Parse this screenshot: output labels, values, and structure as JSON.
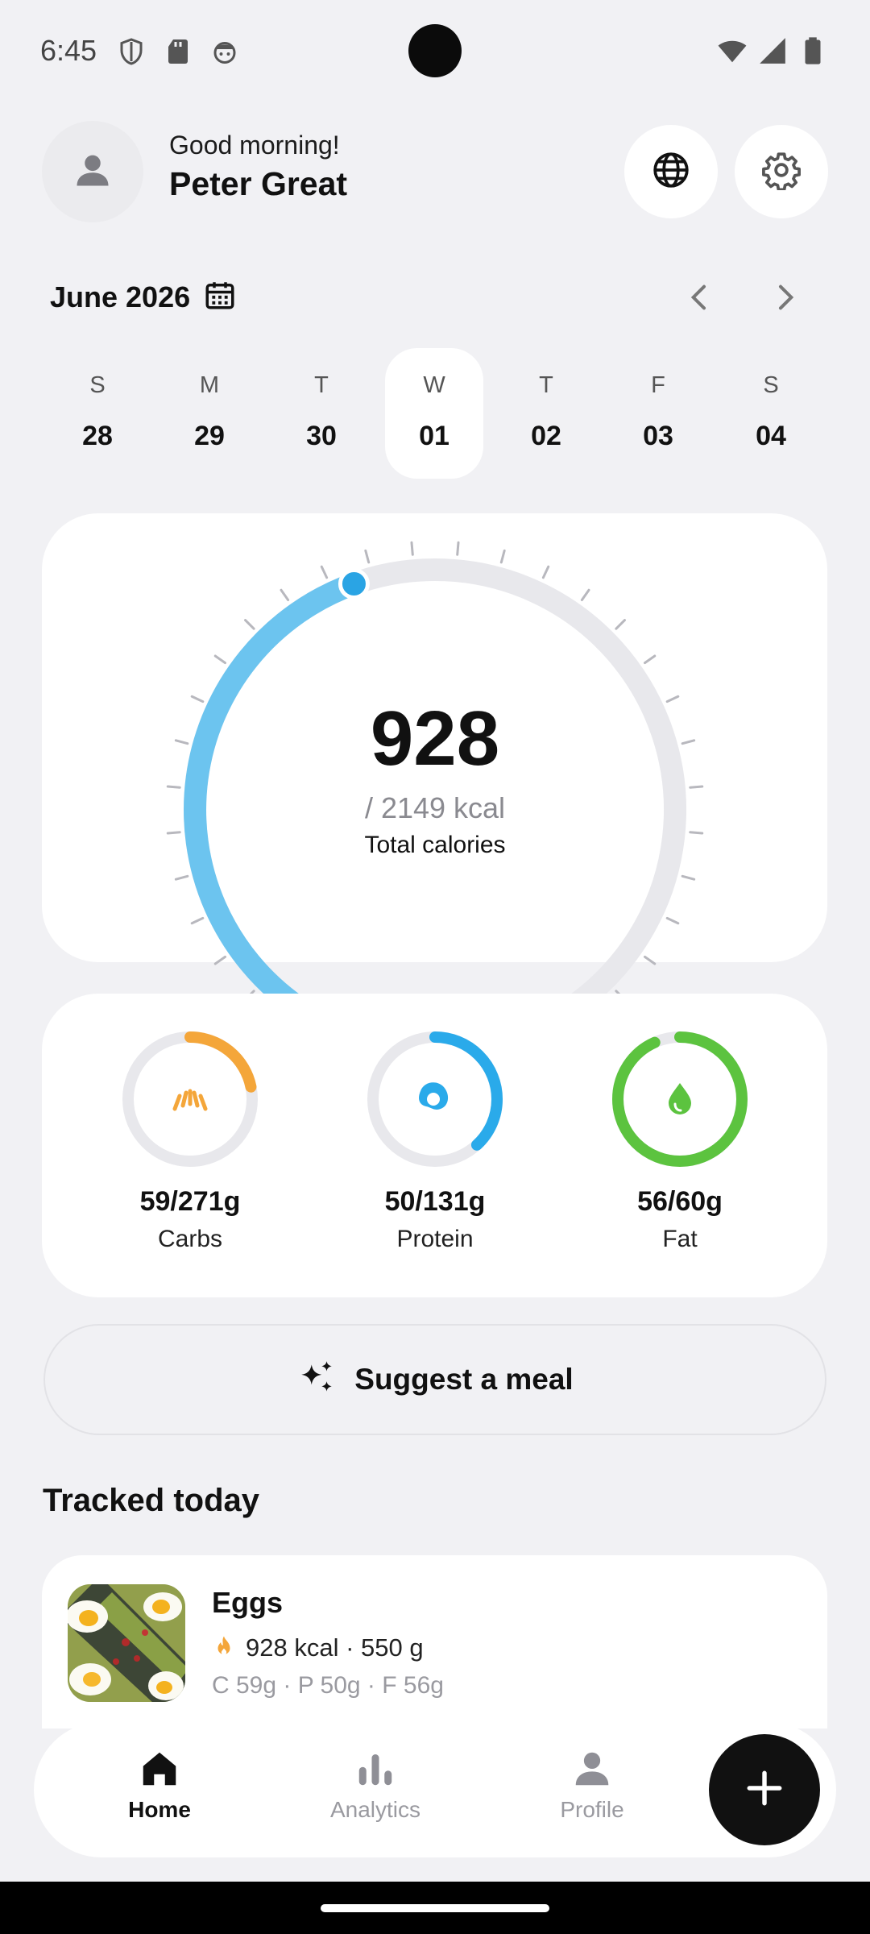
{
  "status_bar": {
    "time": "6:45"
  },
  "header": {
    "greeting": "Good morning!",
    "user_name": "Peter Great"
  },
  "calendar": {
    "month_label": "June 2026",
    "days": [
      {
        "letter": "S",
        "number": "28"
      },
      {
        "letter": "M",
        "number": "29"
      },
      {
        "letter": "T",
        "number": "30"
      },
      {
        "letter": "W",
        "number": "01",
        "selected": true
      },
      {
        "letter": "T",
        "number": "02"
      },
      {
        "letter": "F",
        "number": "03"
      },
      {
        "letter": "S",
        "number": "04"
      }
    ]
  },
  "calories": {
    "consumed": "928",
    "goal_text": "/ 2149 kcal",
    "label": "Total calories",
    "progress": 0.432,
    "color": "#6cc4ef"
  },
  "macros": [
    {
      "value": "59/271g",
      "name": "Carbs",
      "progress": 0.218,
      "color": "#f4a63a",
      "icon": "croissant-icon"
    },
    {
      "value": "50/131g",
      "name": "Protein",
      "progress": 0.382,
      "color": "#2aaaea",
      "icon": "egg-icon"
    },
    {
      "value": "56/60g",
      "name": "Fat",
      "progress": 0.933,
      "color": "#5cc33f",
      "icon": "drop-icon"
    }
  ],
  "suggest": {
    "label": "Suggest a meal"
  },
  "tracked": {
    "title": "Tracked today",
    "items": [
      {
        "name": "Eggs",
        "calories": "928 kcal · 550 g",
        "macros": "C 59g · P 50g · F 56g"
      }
    ]
  },
  "bottom_nav": {
    "items": [
      {
        "label": "Home",
        "icon": "home-icon",
        "active": true
      },
      {
        "label": "Analytics",
        "icon": "bar-chart-icon"
      },
      {
        "label": "Profile",
        "icon": "person-icon"
      }
    ],
    "fab_icon": "plus-icon"
  },
  "colors": {
    "background": "#f1f1f4",
    "card": "#ffffff",
    "accent_dark": "#111111"
  }
}
